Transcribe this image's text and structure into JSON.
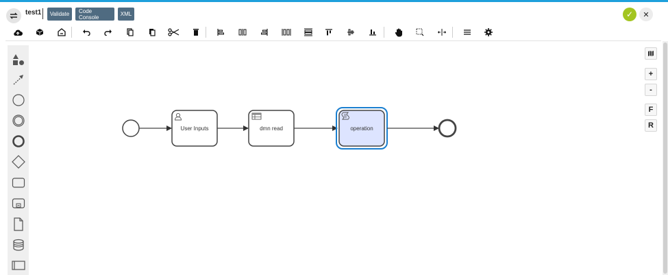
{
  "header": {
    "title": "test1",
    "buttons": {
      "validate": "Validate",
      "code_console": "Code Console",
      "xml": "XML"
    },
    "swap_icon": "swap-arrows-icon",
    "confirm_icon": "check-icon",
    "close_icon": "close-icon"
  },
  "toolbar": {
    "items": [
      "cloud-upload-icon",
      "cube-icon",
      "import-icon",
      "undo-icon",
      "redo-icon",
      "copy-icon",
      "paste-icon",
      "cut-icon",
      "delete-icon",
      "align-left-icon",
      "align-center-icon",
      "align-right-icon",
      "distribute-horizontal-icon",
      "distribute-vertical-icon",
      "align-top-icon",
      "align-middle-icon",
      "align-bottom-icon",
      "hand-tool-icon",
      "lasso-tool-icon",
      "space-tool-icon",
      "menu-icon",
      "settings-icon"
    ]
  },
  "palette": {
    "items": [
      "shapes-icon",
      "connector-icon",
      "start-event-icon",
      "intermediate-event-icon",
      "end-event-icon",
      "gateway-icon",
      "task-icon",
      "subprocess-icon",
      "data-object-icon",
      "data-store-icon",
      "pool-icon"
    ]
  },
  "right_controls": {
    "minimap_icon": "map-icon",
    "zoom_in": "+",
    "zoom_out": "-",
    "fit": "F",
    "reset": "R"
  },
  "diagram": {
    "tasks": [
      {
        "label": "User Inputs",
        "type": "user-task",
        "icon": "user-icon"
      },
      {
        "label": "dmn read",
        "type": "business-rule-task",
        "icon": "table-icon"
      },
      {
        "label": "operation",
        "type": "script-task",
        "icon": "script-icon",
        "selected": true
      }
    ]
  },
  "colors": {
    "accent": "#1ea0dc",
    "header_button": "#4f6b81",
    "confirm": "#a3c520",
    "selected_fill": "#dde4ff",
    "selected_border": "#1a7fd0"
  }
}
